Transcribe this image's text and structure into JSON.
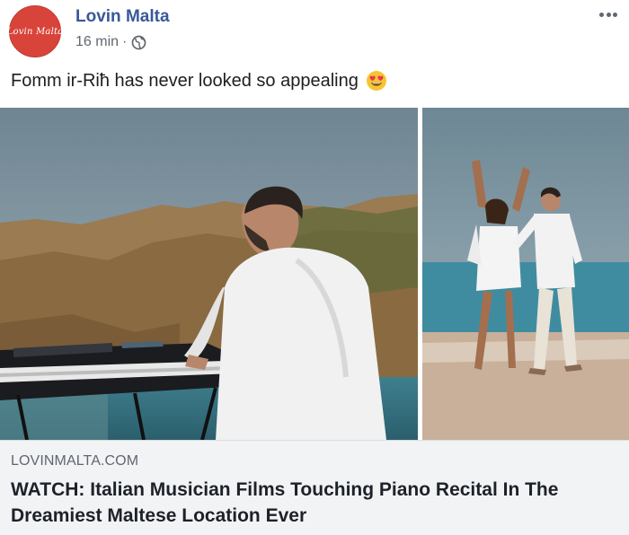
{
  "post": {
    "page_name": "Lovin Malta",
    "avatar_text": "Lovin Malta",
    "time": "16 min",
    "separator": "·",
    "privacy_icon": "globe-icon",
    "more_icon": "ellipsis-icon",
    "caption": "Fomm ir-Riħ has never looked so appealing",
    "caption_emoji": "heart-eyes-emoji-icon"
  },
  "media": {
    "photos": [
      {
        "name": "man-playing-keyboard-on-cliff"
      },
      {
        "name": "couple-dancing-on-beach"
      }
    ]
  },
  "link": {
    "domain": "LOVINMALTA.COM",
    "title": "WATCH: Italian Musician Films Touching Piano Recital In The Dreamiest Maltese Location Ever"
  },
  "colors": {
    "brand_blue": "#385898",
    "avatar_red": "#d9443a",
    "meta_gray": "#606770",
    "link_bg": "#f2f3f5"
  }
}
